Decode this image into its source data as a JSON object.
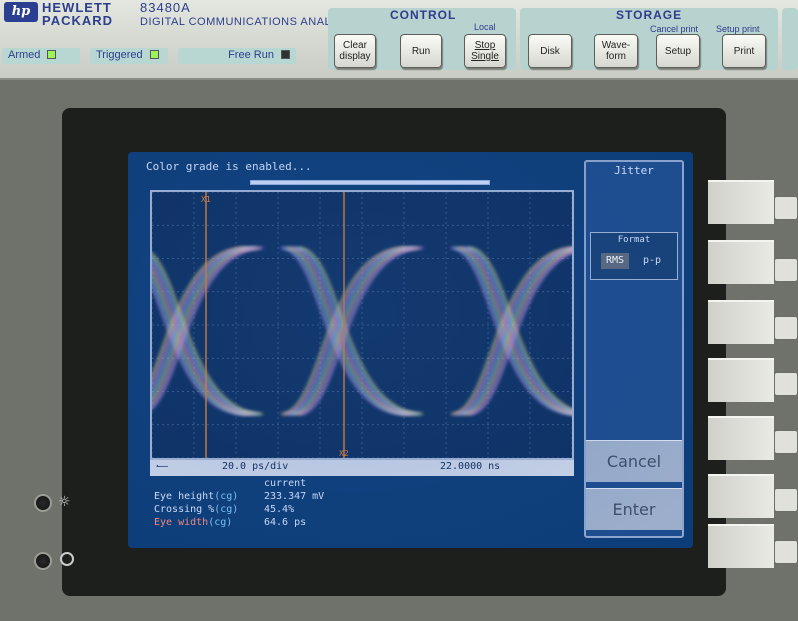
{
  "brand": {
    "logo_text": "hp",
    "line1": "HEWLETT",
    "line2": "PACKARD",
    "model": "83480A",
    "subtitle": "DIGITAL COMMUNICATIONS ANALYZER"
  },
  "status": {
    "armed": "Armed",
    "triggered": "Triggered",
    "free_run": "Free Run"
  },
  "control": {
    "title": "CONTROL",
    "local": "Local",
    "clear_display": "Clear display",
    "run": "Run",
    "stop_single": "Stop Single"
  },
  "storage": {
    "title": "STORAGE",
    "cancel_print": "Cancel print",
    "setup_print": "Setup print",
    "disk": "Disk",
    "waveform": "Wave-form",
    "setup": "Setup",
    "print": "Print"
  },
  "screen": {
    "message": "Color grade is enabled...",
    "scale": "20.0 ps/div",
    "time": "22.0000 ns",
    "marker_1": "X1",
    "marker_2": "X2"
  },
  "measurements": {
    "header": "current",
    "rows": [
      {
        "label": "Eye height",
        "source": "(cg)",
        "value": "233.347 mV"
      },
      {
        "label": "Crossing %",
        "source": "(cg)",
        "value": "45.4%"
      },
      {
        "label": "Eye width",
        "source": "(cg)",
        "value": "64.6 ps"
      }
    ]
  },
  "menu": {
    "title": "Jitter",
    "format_title": "Format",
    "rms": "RMS",
    "pp": "p-p",
    "selected_format": "RMS",
    "cancel": "Cancel",
    "enter": "Enter"
  },
  "colors": {
    "screen_bg": "#0d3d78",
    "plot_bg": "#0c2f61",
    "marker": "#e8812e",
    "eye_pink": "#e8a0ff",
    "eye_cyan": "#80e0ff",
    "eye_yellow": "#ffe880"
  },
  "icons": {
    "logo": "hp-logo-icon",
    "light": "light-sensor-icon",
    "arrow": "scale-arrow-icon"
  }
}
